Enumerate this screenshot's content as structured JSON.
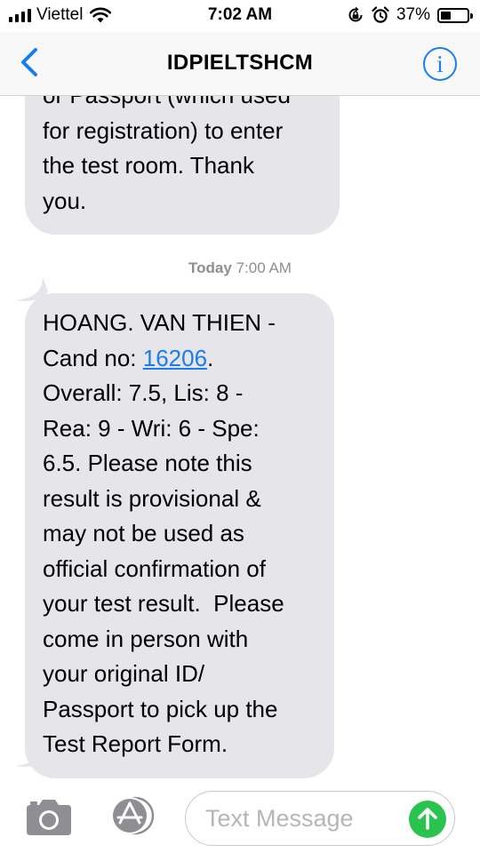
{
  "status_bar": {
    "carrier": "Viettel",
    "time": "7:02 AM",
    "battery_percent": "37%",
    "battery_level": 0.37,
    "icons": [
      "signal-bars-icon",
      "wifi-icon",
      "rotation-lock-icon",
      "alarm-icon",
      "battery-icon"
    ]
  },
  "header": {
    "title": "IDPIELTSHCM",
    "back_icon": "chevron-left-icon",
    "info_label": "i",
    "accent_color": "#1a7cf0"
  },
  "messages": [
    {
      "direction": "incoming",
      "lines": [
        "or Passport (which used",
        "for registration) to enter",
        "the test room. Thank",
        "you."
      ]
    },
    {
      "direction": "incoming",
      "line1": "HOANG. VAN THIEN -",
      "cand_prefix": "Cand no: ",
      "cand_number": "16206",
      "cand_suffix": ".",
      "lines": [
        "Overall: 7.5, Lis: 8 -",
        "Rea: 9 - Wri: 6 - Spe:",
        "6.5. Please note this",
        "result is provisional &",
        "may not be used as",
        "official confirmation of",
        "your test result.  Please",
        "come in person with",
        "your original ID/",
        "Passport to pick up the",
        "Test Report Form."
      ]
    }
  ],
  "timestamp": {
    "day": "Today",
    "time": "7:00 AM"
  },
  "input_bar": {
    "placeholder": "Text Message",
    "camera_icon": "camera-icon",
    "appstore_icon": "app-store-icon",
    "send_icon": "arrow-up-icon",
    "send_color": "#2ac34f"
  },
  "colors": {
    "incoming_bubble": "#e5e5ea",
    "link": "#1a7cf0",
    "timestamp_text": "#8e8e93"
  }
}
